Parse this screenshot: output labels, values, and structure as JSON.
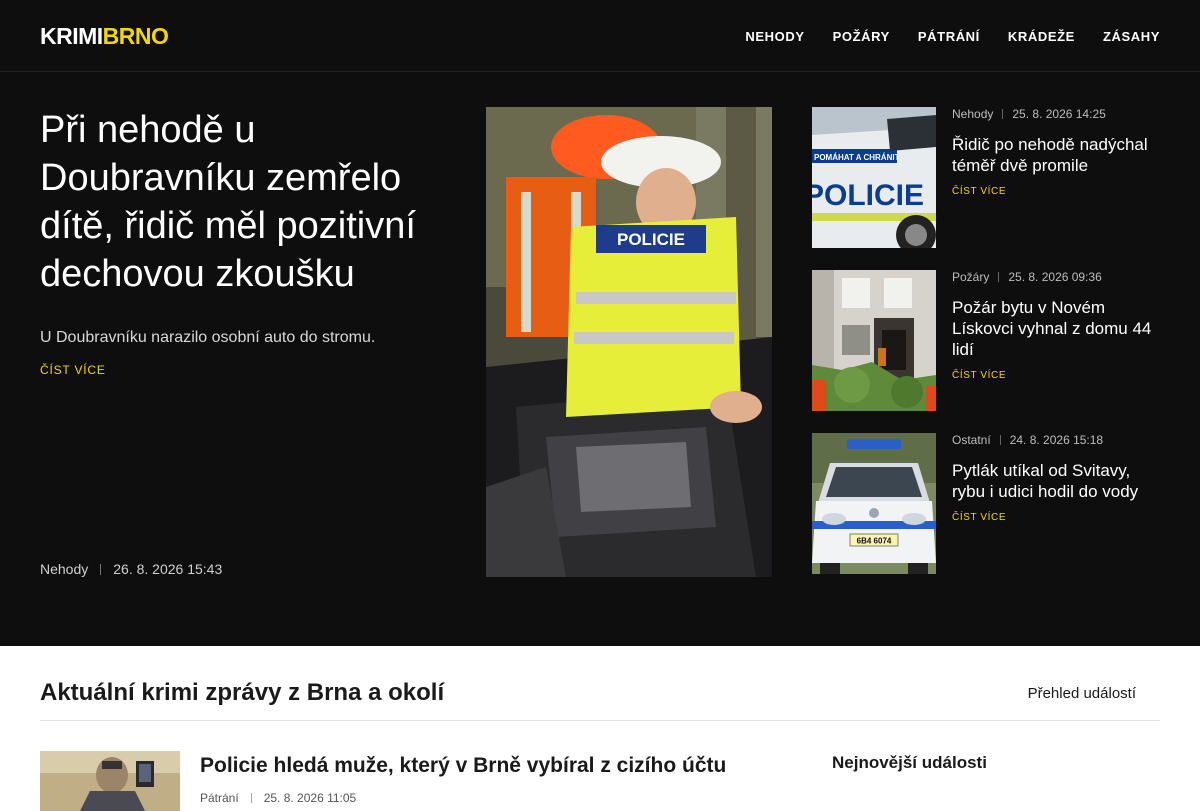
{
  "header": {
    "logo_part1": "KRIMI",
    "logo_part2": "BRNO",
    "nav": [
      "NEHODY",
      "POŽÁRY",
      "PÁTRÁNÍ",
      "KRÁDEŽE",
      "ZÁSAHY"
    ]
  },
  "colors": {
    "accent": "#f2d600",
    "dark_bg": "#0e0e0e"
  },
  "lead": {
    "title": "Při nehodě u Doubravníku zemřelo dítě, řidič měl pozitivní dechovou zkoušku",
    "perex": "U Doubravníku narazilo osobní auto do stromu.",
    "read_more": "ČÍST VÍCE",
    "category": "Nehody",
    "date": "26. 8. 2026 15:43",
    "image_icon": "police-accident-photo"
  },
  "side_articles": [
    {
      "category": "Nehody",
      "date": "25. 8. 2026 14:25",
      "title": "Řidič po nehodě nadýchal téměř dvě promile",
      "read_more": "ČÍST VÍCE"
    },
    {
      "category": "Požáry",
      "date": "25. 8. 2026 09:36",
      "title": "Požár bytu v Novém Lískovci vyhnal z domu 44 lidí",
      "read_more": "ČÍST VÍCE"
    },
    {
      "category": "Ostatní",
      "date": "24. 8. 2026 15:18",
      "title": "Pytlák utíkal od Svitavy, rybu i udici hodil do vody",
      "read_more": "ČÍST VÍCE"
    }
  ],
  "thumb_text": {
    "police_car_slogan": "POMÁHAT A CHRÁNIT",
    "police_car_word": "POLICIE",
    "police_vest_word": "POLICIE",
    "plate": "6B4 6074"
  },
  "section": {
    "title": "Aktuální krimi zprávy z Brna a okolí",
    "overview_link": "Přehled událostí"
  },
  "news": [
    {
      "title": "Policie hledá muže, který v Brně vybíral z cizího účtu",
      "category": "Pátrání",
      "date": "25. 8. 2026 11:05"
    }
  ],
  "sidebar": {
    "latest_title": "Nejnovější události"
  }
}
